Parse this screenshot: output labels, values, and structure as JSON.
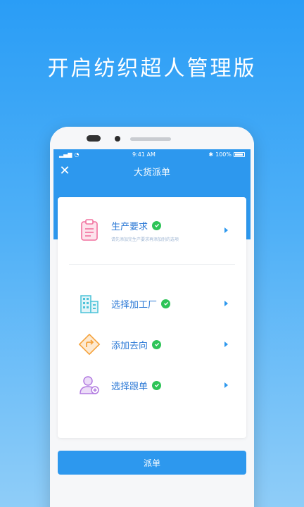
{
  "headline": "开启纺织超人管理版",
  "status": {
    "time": "9:41 AM",
    "battery": "100%"
  },
  "nav": {
    "title": "大货派单"
  },
  "rows": [
    {
      "title": "生产要求",
      "subtitle": "请先添加完生产要求再添加别的选项",
      "icon": "clipboard-icon"
    },
    {
      "title": "选择加工厂",
      "subtitle": "",
      "icon": "factory-icon"
    },
    {
      "title": "添加去向",
      "subtitle": "",
      "icon": "direction-icon"
    },
    {
      "title": "选择跟单",
      "subtitle": "",
      "icon": "user-icon"
    }
  ],
  "submit_label": "派单",
  "colors": {
    "accent": "#2d98ee",
    "check": "#2ec458"
  }
}
